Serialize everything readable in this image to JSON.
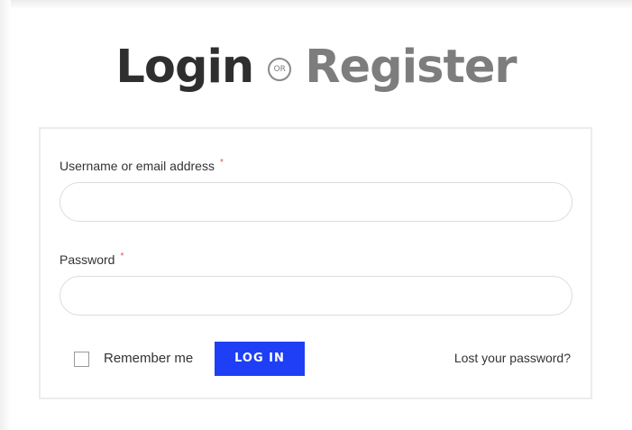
{
  "heading": {
    "login": "Login",
    "or": "OR",
    "register": "Register"
  },
  "form": {
    "username_label": "Username or email address",
    "username_value": "",
    "password_label": "Password",
    "password_value": "",
    "required_marker": "*",
    "remember_label": "Remember me",
    "remember_checked": false,
    "login_button": "LOG IN",
    "lost_password": "Lost your password?"
  },
  "colors": {
    "login_heading": "#2f2f2f",
    "register_heading": "#7d7d7d",
    "button_bg": "#1e3ff5",
    "required_marker": "#e0524f"
  }
}
